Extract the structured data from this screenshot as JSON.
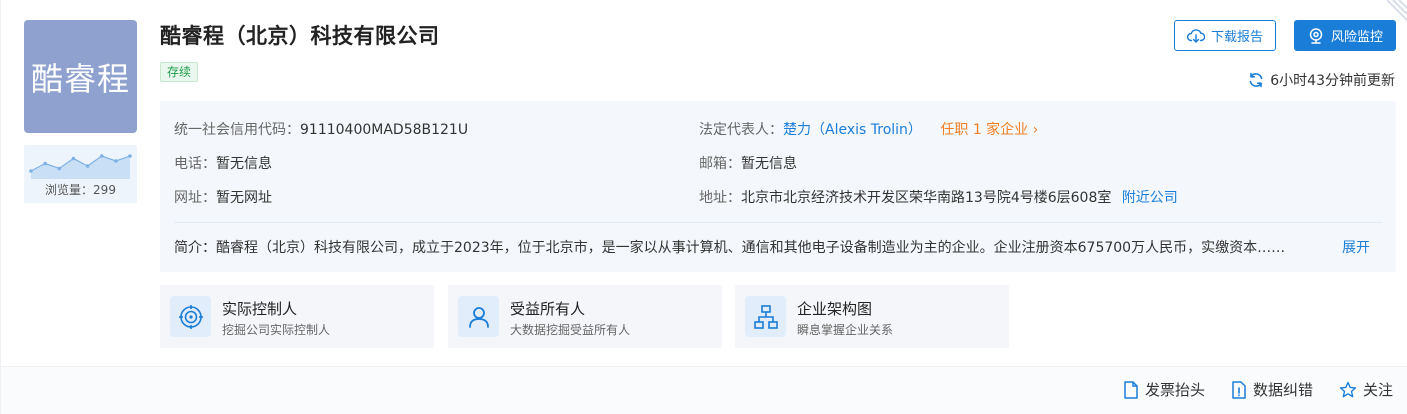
{
  "company": {
    "logo_text": "酷睿程",
    "name": "酷睿程（北京）科技有限公司",
    "status": "存续",
    "views_label": "浏览量：299",
    "views_trend": [
      2,
      5,
      3,
      7,
      4,
      8,
      6,
      8
    ]
  },
  "actions": {
    "download_report": "下载报告",
    "risk_monitor": "风险监控",
    "updated": "6小时43分钟前更新"
  },
  "info": {
    "credit_code_label": "统一社会信用代码：",
    "credit_code": "91110400MAD58B121U",
    "legal_rep_label": "法定代表人：",
    "legal_rep": "楚力（Alexis Trolin）",
    "legal_rep_roles": "任职 1 家企业",
    "phone_label": "电话：",
    "phone": "暂无信息",
    "email_label": "邮箱：",
    "email": "暂无信息",
    "website_label": "网址：",
    "website": "暂无网址",
    "address_label": "地址：",
    "address": "北京市北京经济技术开发区荣华南路13号院4号楼6层608室",
    "nearby": "附近公司",
    "intro_label": "简介：",
    "intro": "酷睿程（北京）科技有限公司，成立于2023年，位于北京市，是一家以从事计算机、通信和其他电子设备制造业为主的企业。企业注册资本675700万人民币，实缴资本……",
    "expand": "展开"
  },
  "features": [
    {
      "title": "实际控制人",
      "desc": "挖掘公司实际控制人",
      "icon": "target-icon"
    },
    {
      "title": "受益所有人",
      "desc": "大数据挖掘受益所有人",
      "icon": "person-icon"
    },
    {
      "title": "企业架构图",
      "desc": "瞬息掌握企业关系",
      "icon": "org-chart-icon"
    }
  ],
  "footer": {
    "invoice": "发票抬头",
    "correction": "数据纠错",
    "follow": "关注"
  },
  "colors": {
    "accent": "#1a7dd8",
    "logo_bg": "#8fa2cf",
    "status_green": "#1f9e4c",
    "orange": "#f07f26"
  }
}
